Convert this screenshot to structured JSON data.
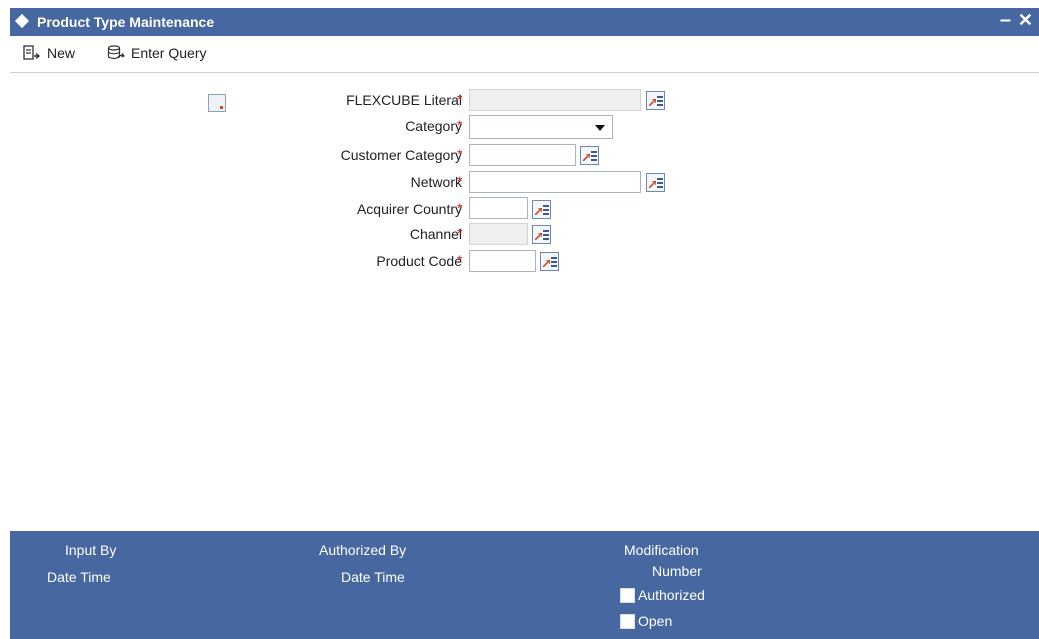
{
  "window": {
    "title": "Product Type Maintenance",
    "minimize_label": "–",
    "close_label": "✕"
  },
  "toolbar": {
    "new_label": "New",
    "enter_query_label": "Enter Query"
  },
  "form": {
    "flexcube_literal": {
      "label": "FLEXCUBE Literal",
      "value": ""
    },
    "category": {
      "label": "Category",
      "value": ""
    },
    "customer_category": {
      "label": "Customer Category",
      "value": ""
    },
    "network": {
      "label": "Network",
      "value": ""
    },
    "acquirer_country": {
      "label": "Acquirer Country",
      "value": ""
    },
    "channel": {
      "label": "Channel",
      "value": ""
    },
    "product_code": {
      "label": "Product Code",
      "value": ""
    },
    "required_marker": "*"
  },
  "footer": {
    "input_by": "Input By",
    "date_time_1": "Date Time",
    "authorized_by": "Authorized By",
    "date_time_2": "Date Time",
    "modification": "Modification",
    "number": "Number",
    "authorized": "Authorized",
    "open": "Open"
  },
  "colors": {
    "header_bg": "#46679f",
    "required": "#d02020"
  }
}
